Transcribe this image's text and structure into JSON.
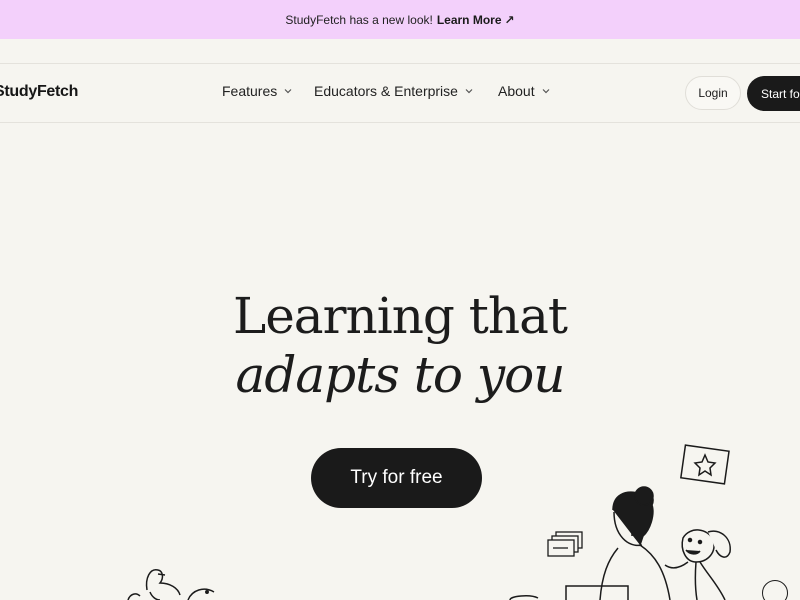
{
  "banner": {
    "text": "StudyFetch has a new look!",
    "link_label": "Learn More",
    "arrow": "↗"
  },
  "nav": {
    "logo": "StudyFetch",
    "items": [
      {
        "label": "Features",
        "icon": "chevron-down-icon"
      },
      {
        "label": "Educators & Enterprise",
        "icon": "chevron-down-icon"
      },
      {
        "label": "About",
        "icon": "chevron-down-icon"
      }
    ],
    "login_label": "Login",
    "start_label": "Start for free"
  },
  "hero": {
    "line1": "Learning that",
    "line2": "adapts to you",
    "cta_label": "Try for free"
  },
  "illustration": {
    "icons": [
      "star-card-icon",
      "person-reading-icon",
      "dog-icon",
      "stacked-cards-icon",
      "bird-icon",
      "speaker-icon"
    ]
  },
  "colors": {
    "banner_bg": "#f3d0fb",
    "page_bg": "#f6f5f0",
    "button_dark": "#1a1a1a"
  }
}
